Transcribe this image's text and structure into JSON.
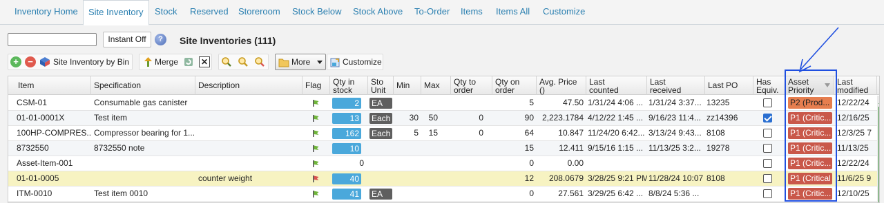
{
  "tabs": [
    {
      "label": "Inventory Home",
      "active": false
    },
    {
      "label": "Site Inventory",
      "active": true
    },
    {
      "label": "Stock",
      "active": false
    },
    {
      "label": "Reserved",
      "active": false
    },
    {
      "label": "Storeroom",
      "active": false
    },
    {
      "label": "Stock Below",
      "active": false
    },
    {
      "label": "Stock Above",
      "active": false
    },
    {
      "label": "To-Order",
      "active": false
    },
    {
      "label": "Items",
      "active": false
    },
    {
      "label": "Items All",
      "active": false
    },
    {
      "label": "Customize",
      "active": false
    }
  ],
  "search": {
    "value": "",
    "placeholder": ""
  },
  "instant_label": "Instant Off",
  "help_glyph": "?",
  "page_title": "Site Inventories (111)",
  "toolbar": {
    "site_inventory_by_bin": "Site Inventory by Bin",
    "merge": "Merge",
    "more": "More",
    "customize": "Customize"
  },
  "colors": {
    "qty_bar": "#4aa8db",
    "unit_badge": "#5f5f5f",
    "priority_p1": "#c9584a",
    "priority_p2": "#e67e4f",
    "highlight_row": "#f7f3c2",
    "flag_green": "#6fb53a",
    "flag_red": "#d9534f",
    "annotation": "#1f4fe0"
  },
  "columns": [
    {
      "key": "item",
      "label1": "Item",
      "label2": ""
    },
    {
      "key": "spec",
      "label1": "Specification",
      "label2": ""
    },
    {
      "key": "desc",
      "label1": "Description",
      "label2": ""
    },
    {
      "key": "flag",
      "label1": "Flag",
      "label2": ""
    },
    {
      "key": "qty_in_stock",
      "label1": "Qty in",
      "label2": "stock"
    },
    {
      "key": "stock_unit",
      "label1": "Sto",
      "label2": "Unit"
    },
    {
      "key": "min",
      "label1": "Min",
      "label2": ""
    },
    {
      "key": "max",
      "label1": "Max",
      "label2": ""
    },
    {
      "key": "qty_to_order",
      "label1": "Qty to",
      "label2": "order"
    },
    {
      "key": "qty_on_order",
      "label1": "Qty on",
      "label2": "order"
    },
    {
      "key": "avg_price",
      "label1": "Avg. Price",
      "label2": "()"
    },
    {
      "key": "last_counted",
      "label1": "Last",
      "label2": "counted"
    },
    {
      "key": "last_received",
      "label1": "Last",
      "label2": "received"
    },
    {
      "key": "last_po",
      "label1": "Last PO",
      "label2": ""
    },
    {
      "key": "has_equiv",
      "label1": "Has",
      "label2": "Equiv."
    },
    {
      "key": "asset_priority",
      "label1": "Asset",
      "label2": "Priority"
    },
    {
      "key": "last_modified",
      "label1": "Last",
      "label2": "modified"
    }
  ],
  "rows": [
    {
      "item": "CSM-01",
      "spec": "Consumable gas canister",
      "desc": "",
      "flag": "green",
      "qty": "2",
      "qty_fill": 0.9,
      "unit": "EA",
      "min": "",
      "max": "",
      "to_order": "",
      "on_order": "5",
      "avg_price": "47.50",
      "last_counted": "1/31/24 4:06 ...",
      "last_received": "1/31/24 3:37...",
      "last_po": "13235",
      "has_equiv": false,
      "priority": "P2 (Prod...",
      "priority_level": "p2",
      "last_modified": "12/22/24",
      "highlight": false
    },
    {
      "item": "01-01-0001X",
      "spec": "Test item",
      "desc": "",
      "flag": "green",
      "qty": "13",
      "qty_fill": 0.9,
      "unit": "Each",
      "min": "30",
      "max": "50",
      "to_order": "0",
      "on_order": "90",
      "avg_price": "2,223.1784",
      "last_counted": "4/12/22 1:45 ...",
      "last_received": "9/16/23 11:4...",
      "last_po": "zz14396",
      "has_equiv": true,
      "priority": "P1 (Critic...",
      "priority_level": "p1",
      "last_modified": "12/16/25",
      "highlight": false
    },
    {
      "item": "100HP-COMPRES...",
      "spec": "Compressor bearing for 1...",
      "desc": "",
      "flag": "green",
      "qty": "162",
      "qty_fill": 0.9,
      "unit": "Each",
      "min": "5",
      "max": "15",
      "to_order": "0",
      "on_order": "64",
      "avg_price": "10.847",
      "last_counted": "11/24/20 6:42...",
      "last_received": "3/13/24 9:43...",
      "last_po": "8108",
      "has_equiv": false,
      "priority": "P1 (Critic...",
      "priority_level": "p1",
      "last_modified": "12/3/25 7",
      "highlight": false
    },
    {
      "item": "8732550",
      "spec": "8732550 note",
      "desc": "",
      "flag": "green",
      "qty": "10",
      "qty_fill": 0.9,
      "unit": "",
      "min": "",
      "max": "",
      "to_order": "",
      "on_order": "15",
      "avg_price": "12.411",
      "last_counted": "9/15/16 1:15 ...",
      "last_received": "11/13/25 3:2...",
      "last_po": "19278",
      "has_equiv": false,
      "priority": "P1 (Critic...",
      "priority_level": "p1",
      "last_modified": "11/13/25",
      "highlight": false
    },
    {
      "item": "Asset-Item-001",
      "spec": "",
      "desc": "",
      "flag": "green",
      "qty": "0",
      "qty_fill": 0,
      "unit": "",
      "min": "",
      "max": "",
      "to_order": "",
      "on_order": "0",
      "avg_price": "0.00",
      "last_counted": "",
      "last_received": "",
      "last_po": "",
      "has_equiv": false,
      "priority": "P1 (Critic...",
      "priority_level": "p1",
      "last_modified": "12/22/24",
      "highlight": false
    },
    {
      "item": "01-01-0005",
      "spec": "",
      "desc": "counter weight",
      "flag": "red",
      "qty": "40",
      "qty_fill": 0.9,
      "unit": "",
      "min": "",
      "max": "",
      "to_order": "",
      "on_order": "12",
      "avg_price": "208.0679",
      "last_counted": "3/28/25 9:21 PM",
      "last_received": "11/28/24 10:07",
      "last_po": "8108",
      "has_equiv": false,
      "priority": "P1 (Critical",
      "priority_level": "p1",
      "last_modified": "11/6/25 9",
      "highlight": true
    },
    {
      "item": "ITM-0010",
      "spec": "Test item 0010",
      "desc": "",
      "flag": "green",
      "qty": "41",
      "qty_fill": 0.9,
      "unit": "EA",
      "min": "",
      "max": "",
      "to_order": "",
      "on_order": "0",
      "avg_price": "27.561",
      "last_counted": "3/29/25 6:42 ...",
      "last_received": "8/8/24 5:36 ...",
      "last_po": "",
      "has_equiv": false,
      "priority": "P1 (Critic...",
      "priority_level": "p1",
      "last_modified": "12/10/25",
      "highlight": false
    }
  ]
}
